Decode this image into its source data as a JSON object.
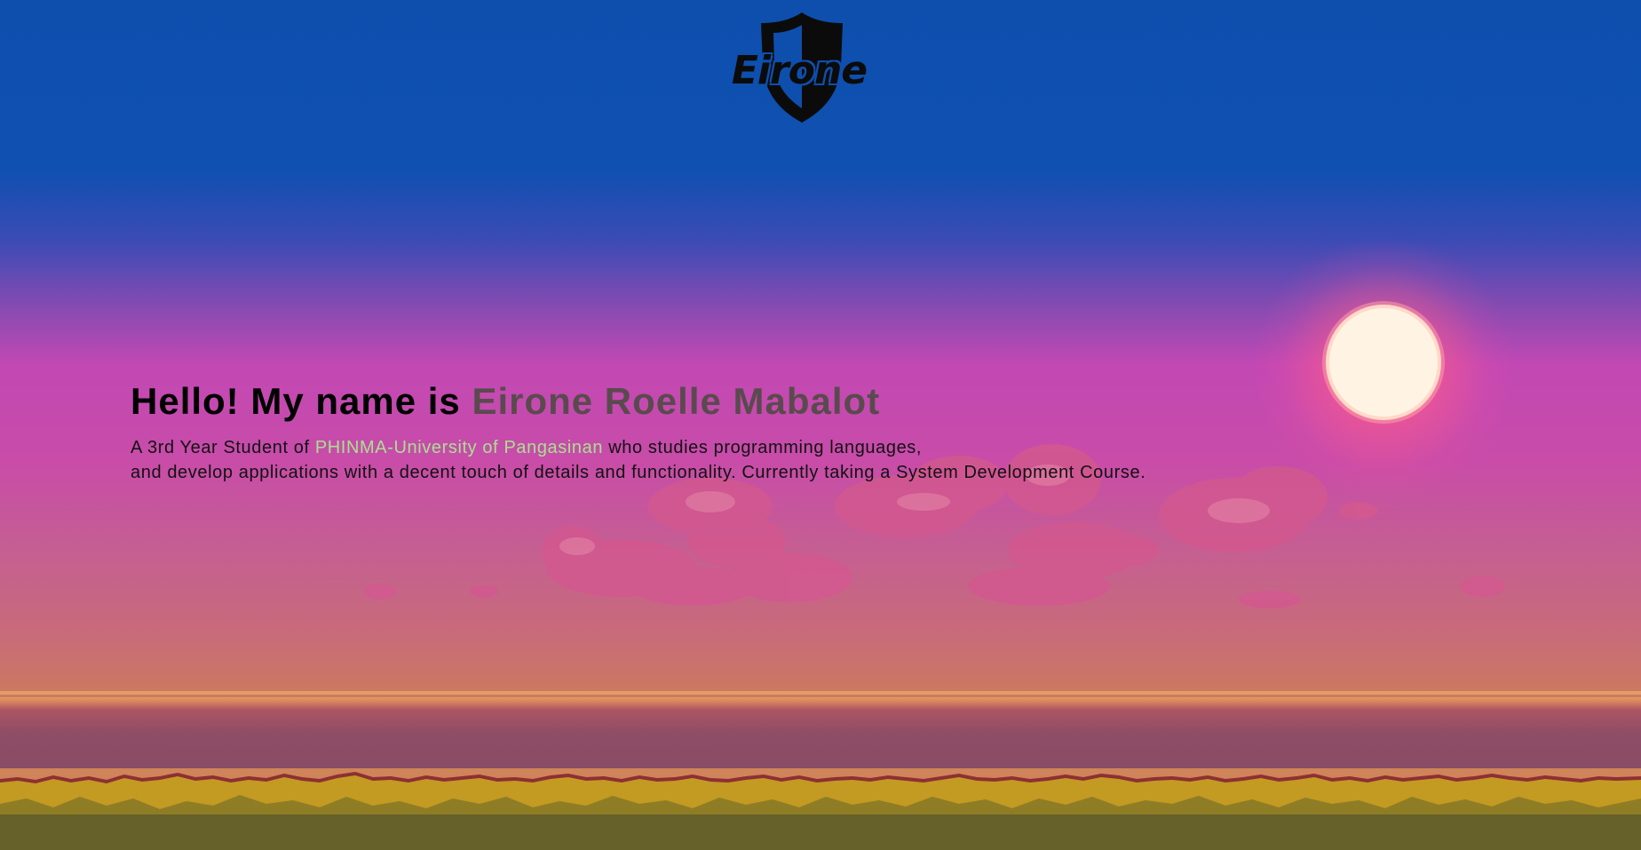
{
  "logo": {
    "text": "Eirone",
    "icon": "shield-icon"
  },
  "hero": {
    "greeting": "Hello! My name is ",
    "name": "Eirone Roelle Mabalot",
    "bio_prefix": "A 3rd Year Student of ",
    "school": "PHINMA-University of Pangasinan",
    "bio_line1_suffix": " who studies programming languages,",
    "bio_line2": "and develop applications with a decent touch of details and functionality. Currently taking a System Development Course."
  },
  "colors": {
    "sky_top": "#0e4fae",
    "sky_mid": "#c248b4",
    "horizon": "#cf8459",
    "sun": "#fff4e4",
    "name_accent": "#5a4a4e",
    "school_accent": "#a9e08f",
    "grass_light": "#c39a22",
    "grass_dark": "#66612a"
  },
  "scene": {
    "background": "pixel-art sunset landscape",
    "sun_icon": "sun-icon",
    "cloud_icon": "cloud-icon"
  }
}
